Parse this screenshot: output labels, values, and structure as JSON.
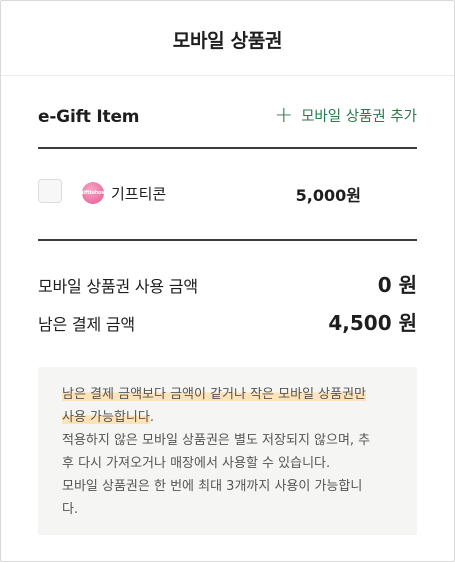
{
  "page": {
    "title": "모바일 상품권"
  },
  "section": {
    "title": "e-Gift Item",
    "add_label": "모바일 상품권 추가",
    "add_icon": "plus-icon"
  },
  "item": {
    "brand_logo_text": "giftishow",
    "name": "기프티콘",
    "price": "5,000원",
    "checked": false
  },
  "summary": {
    "used_label": "모바일 상품권 사용 금액",
    "used_value": "0 원",
    "remaining_label": "남은 결제 금액",
    "remaining_value": "4,500 원"
  },
  "notice": {
    "highlight_line1": "남은 결제 금액보다 금액이 같거나 작은 모바일 상품권만",
    "highlight_line2": "사용 가능합니다",
    "line2_end": ".",
    "line3": "적용하지 않은 모바일 상품권은 별도 저장되지 않으며, 추",
    "line4": "후 다시 가져오거나 매장에서 사용할 수 있습니다.",
    "line5": "모바일 상품권은 한 번에 최대 3개까지 사용이 가능합니",
    "line6": "다."
  },
  "colors": {
    "accent_green": "#2d7a4a",
    "highlight": "#fde3b7",
    "notice_bg": "#f5f5f4"
  }
}
